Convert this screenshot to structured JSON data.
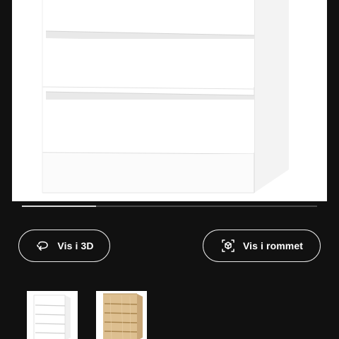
{
  "product_gallery": {
    "image_description_icon": "white-chest-of-drawers-image",
    "colors": {
      "drawer_front": "#ffffff",
      "drawer_shadow": "#e6e6e6",
      "side_panel": "#f2f2f2"
    },
    "scroll_progress": 0.25
  },
  "actions": {
    "view_3d_label": "Vis i 3D",
    "view_3d_icon": "rotate-3d-icon",
    "view_in_room_label": "Vis i rommet",
    "view_in_room_icon": "ar-room-icon"
  },
  "variants": [
    {
      "icon": "white-dresser-thumbnail",
      "color": "#ffffff"
    },
    {
      "icon": "oak-dresser-thumbnail",
      "color": "#d9b98a"
    }
  ],
  "theme": {
    "background": "#111111",
    "text": "#ffffff",
    "button_border": "#e8e8e8"
  }
}
